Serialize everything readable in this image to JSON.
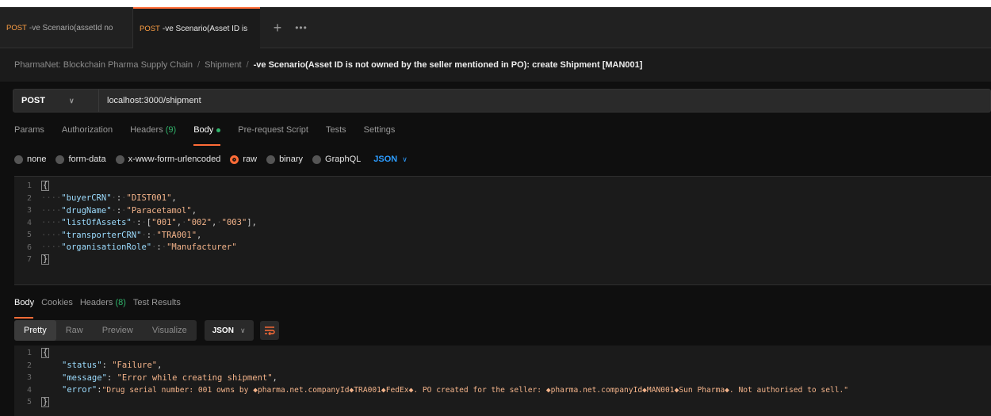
{
  "tabs": [
    {
      "method": "POST",
      "title": "-ve Scenario(assetId no"
    },
    {
      "method": "POST",
      "title": "-ve Scenario(Asset ID is"
    }
  ],
  "tab_add": "+",
  "tab_more": "•••",
  "breadcrumb": {
    "collection": "PharmaNet: Blockchain Pharma Supply Chain",
    "folder": "Shipment",
    "separator": "/",
    "request": "-ve Scenario(Asset ID is not owned by the seller mentioned in PO): create Shipment [MAN001]"
  },
  "request": {
    "method": "POST",
    "url": "localhost:3000/shipment"
  },
  "request_tabs": {
    "params": "Params",
    "authorization": "Authorization",
    "headers": "Headers",
    "headers_count": "(9)",
    "body": "Body",
    "pre_request": "Pre-request Script",
    "tests": "Tests",
    "settings": "Settings"
  },
  "body_types": {
    "none": "none",
    "form_data": "form-data",
    "urlencoded": "x-www-form-urlencoded",
    "raw": "raw",
    "binary": "binary",
    "graphql": "GraphQL",
    "format": "JSON",
    "selected": "raw"
  },
  "request_body": {
    "line_numbers": [
      "1",
      "2",
      "3",
      "4",
      "5",
      "6",
      "7"
    ],
    "key1": "\"buyerCRN\"",
    "val1": "\"DIST001\"",
    "key2": "\"drugName\"",
    "val2": "\"Paracetamol\"",
    "key3": "\"listOfAssets\"",
    "val3a": "\"001\"",
    "val3b": "\"002\"",
    "val3c": "\"003\"",
    "key4": "\"transporterCRN\"",
    "val4": "\"TRA001\"",
    "key5": "\"organisationRole\"",
    "val5": "\"Manufacturer\""
  },
  "response_tabs": {
    "body": "Body",
    "cookies": "Cookies",
    "headers": "Headers",
    "headers_count": "(8)",
    "test_results": "Test Results"
  },
  "view_modes": {
    "pretty": "Pretty",
    "raw": "Raw",
    "preview": "Preview",
    "visualize": "Visualize",
    "format": "JSON"
  },
  "response_body": {
    "line_numbers": [
      "1",
      "2",
      "3",
      "4",
      "5"
    ],
    "key1": "\"status\"",
    "val1": "\"Failure\"",
    "key2": "\"message\"",
    "val2": "\"Error while creating shipment\"",
    "key3": "\"error\"",
    "val3": "\"Drug serial number: 001 owns by \u0000pharma.net.companyId\u0000TRA001\u0000FedEx\u0000. PO created for the seller: \u0000pharma.net.companyId\u0000MAN001\u0000Sun Pharma\u0000. Not authorised to sell.\""
  },
  "colors": {
    "accent": "#ff6c37",
    "method": "#ff9f43",
    "success": "#31b36b",
    "link": "#2c9cff"
  }
}
